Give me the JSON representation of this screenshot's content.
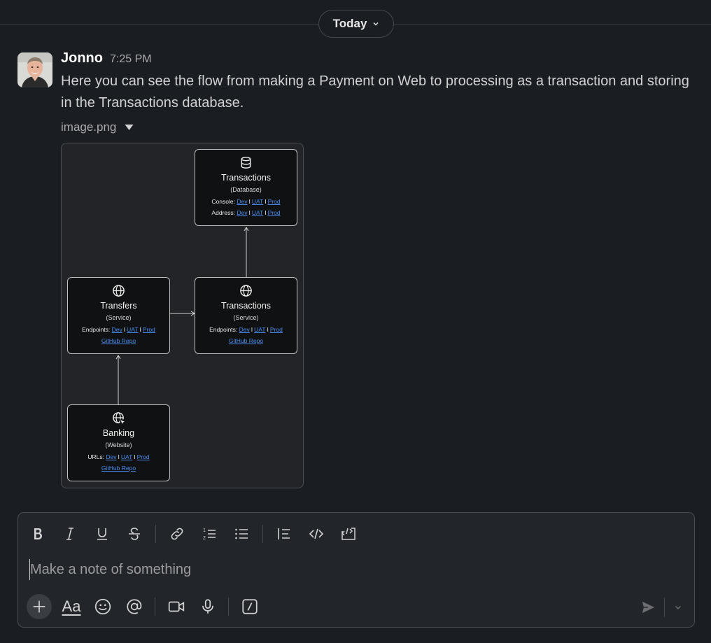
{
  "date_divider": {
    "label": "Today"
  },
  "message": {
    "author": "Jonno",
    "time": "7:25 PM",
    "text": "Here you can see the flow from making a Payment on Web to processing as a transaction and storing in the Transactions database.",
    "attachment": {
      "file_name": "image.png"
    }
  },
  "diagram": {
    "nodes": {
      "transactions_db": {
        "icon": "database-icon",
        "title": "Transactions",
        "subtitle": "(Database)",
        "row1_label": "Console:",
        "row2_label": "Address:"
      },
      "transfers": {
        "icon": "globe-icon",
        "title": "Transfers",
        "subtitle": "(Service)",
        "row1_label": "Endpoints:",
        "repo": "GitHub Repo"
      },
      "transactions_svc": {
        "icon": "globe-icon",
        "title": "Transactions",
        "subtitle": "(Service)",
        "row1_label": "Endpoints:",
        "repo": "GitHub Repo"
      },
      "banking": {
        "icon": "globe-cursor-icon",
        "title": "Banking",
        "subtitle": "(Website)",
        "row1_label": "URLs:",
        "repo": "GitHub Repo"
      }
    },
    "env_links": {
      "dev": "Dev",
      "uat": "UAT",
      "prod": "Prod",
      "separator": "I"
    },
    "edges": [
      {
        "from": "banking",
        "to": "transfers"
      },
      {
        "from": "transfers",
        "to": "transactions_svc"
      },
      {
        "from": "transactions_svc",
        "to": "transactions_db"
      }
    ]
  },
  "composer": {
    "placeholder": "Make a note of something",
    "format_label": "Aa",
    "toolbar_icons": [
      "bold-icon",
      "italic-icon",
      "underline-icon",
      "strikethrough-icon",
      "link-icon",
      "ordered-list-icon",
      "bulleted-list-icon",
      "blockquote-icon",
      "code-icon",
      "code-block-icon"
    ],
    "bottom_icons": [
      "plus-icon",
      "formatting-icon",
      "emoji-icon",
      "mention-icon",
      "video-icon",
      "microphone-icon",
      "shortcuts-icon",
      "send-icon",
      "chevron-down-icon"
    ]
  },
  "colors": {
    "background": "#1a1d21",
    "link": "#4a8cf0",
    "text": "#d1d2d3"
  }
}
